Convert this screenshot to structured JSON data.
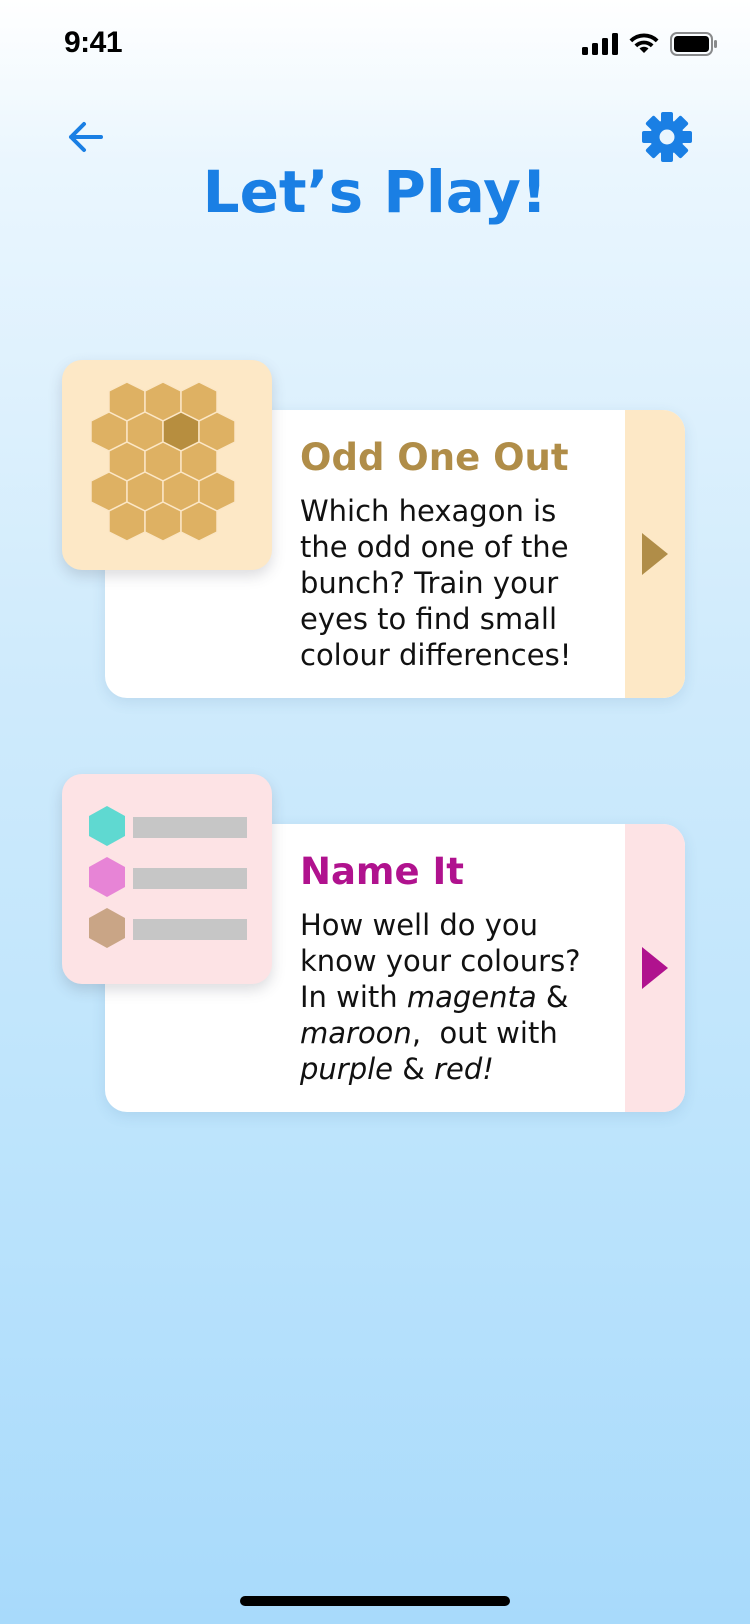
{
  "status_bar": {
    "time": "9:41"
  },
  "header": {
    "title": "Let’s Play!",
    "back_icon": "arrow-left-icon",
    "settings_icon": "gear-icon"
  },
  "colors": {
    "title_blue": "#1a7fe4",
    "odd_accent": "#b08d48",
    "odd_panel": "#fde8c6",
    "odd_hex": "#deb163",
    "odd_hex_dark": "#b78e3f",
    "name_accent": "#b0128e",
    "name_panel": "#fde3e5",
    "name_swatch_teal": "#5fd9d1",
    "name_swatch_pink": "#e784d6",
    "name_swatch_tan": "#c9a586",
    "placeholder_bar": "#c6c6c6"
  },
  "games": [
    {
      "title": "Odd One Out",
      "description_lines": [
        "Which hexagon is",
        "the odd one of the",
        "bunch? Train your",
        "eyes to find small",
        "colour differences!"
      ],
      "play_icon": "play-triangle-icon"
    },
    {
      "title": "Name It",
      "line1": "How well do you",
      "line2": "know your colours?",
      "line3_prefix": "In with ",
      "line3_em": "magenta",
      "line3_suffix": " &",
      "line4_em": "maroon",
      "line4_suffix": ",  out with",
      "line5_em1": "purple",
      "line5_mid": " & ",
      "line5_em2": "red!",
      "play_icon": "play-triangle-icon"
    }
  ]
}
